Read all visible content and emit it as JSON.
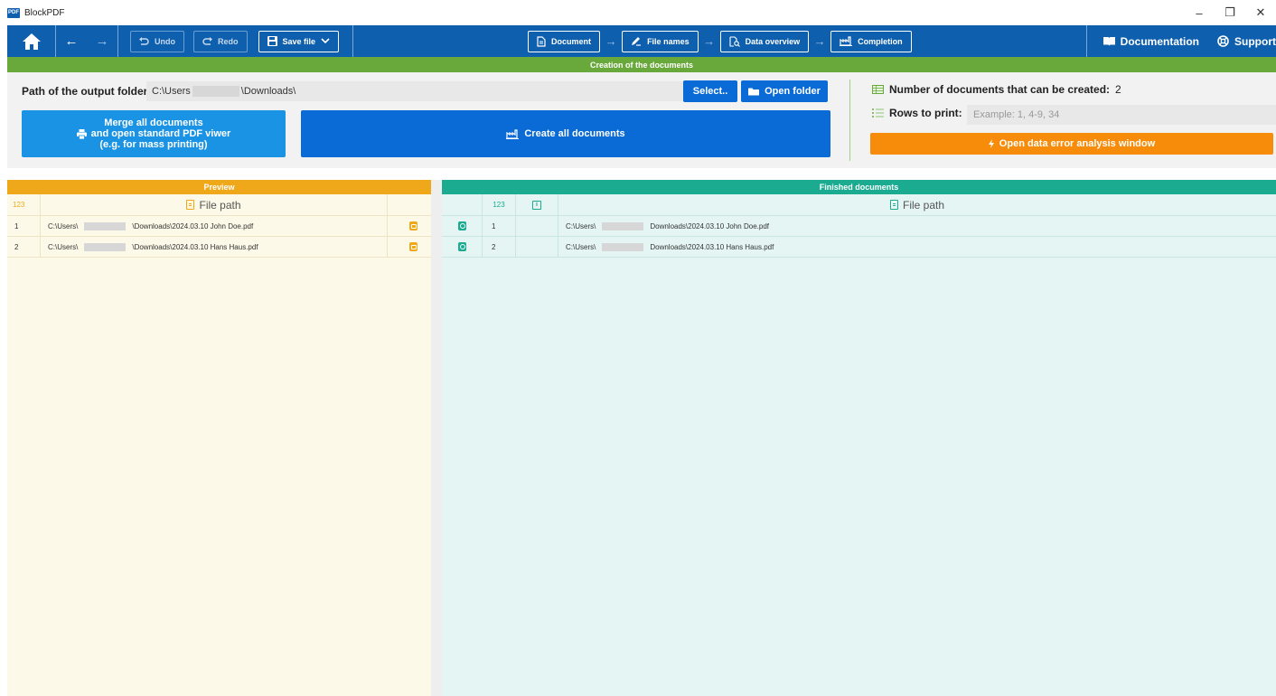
{
  "window": {
    "logo_text": "PDF",
    "title": "BlockPDF",
    "minimize": "–",
    "maximize": "❐",
    "close": "✕"
  },
  "toolbar": {
    "back_arrow": "←",
    "forward_arrow": "→",
    "undo_label": "Undo",
    "redo_label": "Redo",
    "save_label": "Save file",
    "steps": [
      {
        "label": "Document"
      },
      {
        "label": "File names"
      },
      {
        "label": "Data overview"
      },
      {
        "label": "Completion"
      }
    ],
    "step_arrow": "→",
    "documentation_label": "Documentation",
    "support_label": "Support"
  },
  "creation": {
    "banner": "Creation of the documents",
    "path_label": "Path of the output folder:",
    "path_prefix": "C:\\Users",
    "path_suffix": "\\Downloads\\",
    "select_label": "Select..",
    "open_folder_label": "Open folder",
    "merge_line1": "Merge all documents",
    "merge_line2": "and open standard PDF viwer",
    "merge_line3": "(e.g. for mass printing)",
    "create_label": "Create all documents",
    "count_label": "Number of documents that can be created:",
    "count_value": "2",
    "rows_label": "Rows to print:",
    "rows_placeholder": "Example: 1, 4-9, 34",
    "error_label": "Open data error analysis window"
  },
  "preview": {
    "header": "Preview",
    "col_num": "123",
    "col_path": "File path",
    "rows": [
      {
        "num": "1",
        "prefix": "C:\\Users\\",
        "suffix": "\\Downloads\\2024.03.10 John Doe.pdf"
      },
      {
        "num": "2",
        "prefix": "C:\\Users\\",
        "suffix": "\\Downloads\\2024.03.10 Hans Haus.pdf"
      }
    ]
  },
  "finished": {
    "header": "Finished documents",
    "col_num": "123",
    "col_info": "i",
    "col_path": "File path",
    "rows": [
      {
        "num": "1",
        "prefix": "C:\\Users\\",
        "suffix": "Downloads\\2024.03.10 John Doe.pdf"
      },
      {
        "num": "2",
        "prefix": "C:\\Users\\",
        "suffix": "Downloads\\2024.03.10 Hans Haus.pdf"
      }
    ]
  },
  "colors": {
    "toolbar_blue": "#0e5fae",
    "banner_green": "#69a83a",
    "button_blue": "#0a6bd6",
    "merge_blue": "#1a93e5",
    "error_orange": "#f78c0a",
    "preview_yellow": "#f0a81b",
    "finished_teal": "#1aab91"
  }
}
